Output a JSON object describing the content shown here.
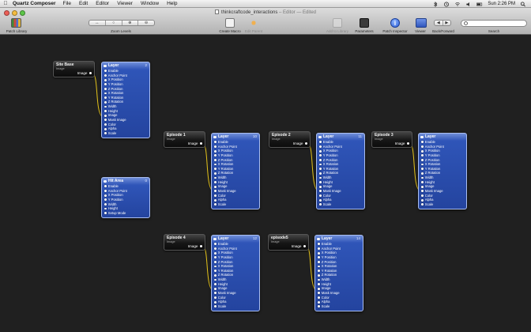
{
  "menubar": {
    "app_name": "Quartz Composer",
    "items": [
      "File",
      "Edit",
      "Editor",
      "Viewer",
      "Window",
      "Help"
    ],
    "clock": "Sun 2:26 PM"
  },
  "window": {
    "title": "thinkcraftcode_interactions",
    "title_suffix": " – Editor — Edited"
  },
  "toolbar": {
    "patch_library": "Patch Library",
    "zoom_levels": "Zoom Levels",
    "create_macro": "Create Macro",
    "edit_parent": "Edit Parent",
    "add_to_library": "Add to Library",
    "parameters": "Parameters",
    "patch_inspector": "Patch Inspector",
    "viewer": "Viewer",
    "back_forward": "Back/Forward",
    "search_label": "Search",
    "search_placeholder": ""
  },
  "colors": {
    "layer_blue": "#2f55b8",
    "wire_yellow": "#e3c21a",
    "canvas": "#202020"
  },
  "patches": {
    "site_base": {
      "title": "Site Base",
      "sub": "Image",
      "out": "Image"
    },
    "episode1": {
      "title": "Episode 1",
      "sub": "Image",
      "out": "Image"
    },
    "episode2": {
      "title": "Episode 2",
      "sub": "Image",
      "out": "Image"
    },
    "episode3": {
      "title": "Episode 3",
      "sub": "Image",
      "out": "Image"
    },
    "episode4": {
      "title": "Episode 4",
      "sub": "Image",
      "out": "Image"
    },
    "episode5": {
      "title": "episode5",
      "sub": "Image",
      "out": "Image"
    },
    "hit_area": {
      "title": "Hit Area",
      "num": "0",
      "ports": [
        "Enable",
        "Anchor Point",
        "X Position",
        "Y Position",
        "Width",
        "Height",
        "Setup Mode"
      ]
    },
    "layer_base": {
      "title": "Layer",
      "num": "2",
      "ports": [
        "Enable",
        "Anchor Point",
        "X Position",
        "Y Position",
        "Z Position",
        "X Rotation",
        "Y Rotation",
        "Z Rotation",
        "Width",
        "Height",
        "Image",
        "Mask Image",
        "Color",
        "Alpha",
        "Scale"
      ]
    },
    "layer_ep1": {
      "title": "Layer",
      "num": "10",
      "ports": [
        "Enable",
        "Anchor Point",
        "X Position",
        "Y Position",
        "Z Position",
        "X Rotation",
        "Y Rotation",
        "Z Rotation",
        "Width",
        "Height",
        "Image",
        "Mask Image",
        "Color",
        "Alpha",
        "Scale"
      ]
    },
    "layer_ep2": {
      "title": "Layer",
      "num": "11",
      "ports": [
        "Enable",
        "Anchor Point",
        "X Position",
        "Y Position",
        "Z Position",
        "X Rotation",
        "Y Rotation",
        "Z Rotation",
        "Width",
        "Height",
        "Image",
        "Mask Image",
        "Color",
        "Alpha",
        "Scale"
      ]
    },
    "layer_ep3": {
      "title": "Layer",
      "num": "",
      "ports": [
        "Enable",
        "Anchor Point",
        "X Position",
        "Y Position",
        "Z Position",
        "X Rotation",
        "Y Rotation",
        "Z Rotation",
        "Width",
        "Height",
        "Image",
        "Mask Image",
        "Color",
        "Alpha",
        "Scale"
      ]
    },
    "layer_ep4": {
      "title": "Layer",
      "num": "12",
      "ports": [
        "Enable",
        "Anchor Point",
        "X Position",
        "Y Position",
        "Z Position",
        "X Rotation",
        "Y Rotation",
        "Z Rotation",
        "Width",
        "Height",
        "Image",
        "Mask Image",
        "Color",
        "Alpha",
        "Scale"
      ]
    },
    "layer_ep5": {
      "title": "Layer",
      "num": "14",
      "ports": [
        "Enable",
        "Anchor Point",
        "X Position",
        "Y Position",
        "Z Position",
        "X Rotation",
        "Y Rotation",
        "Z Rotation",
        "Width",
        "Height",
        "Image",
        "Mask Image",
        "Color",
        "Alpha",
        "Scale"
      ]
    }
  }
}
